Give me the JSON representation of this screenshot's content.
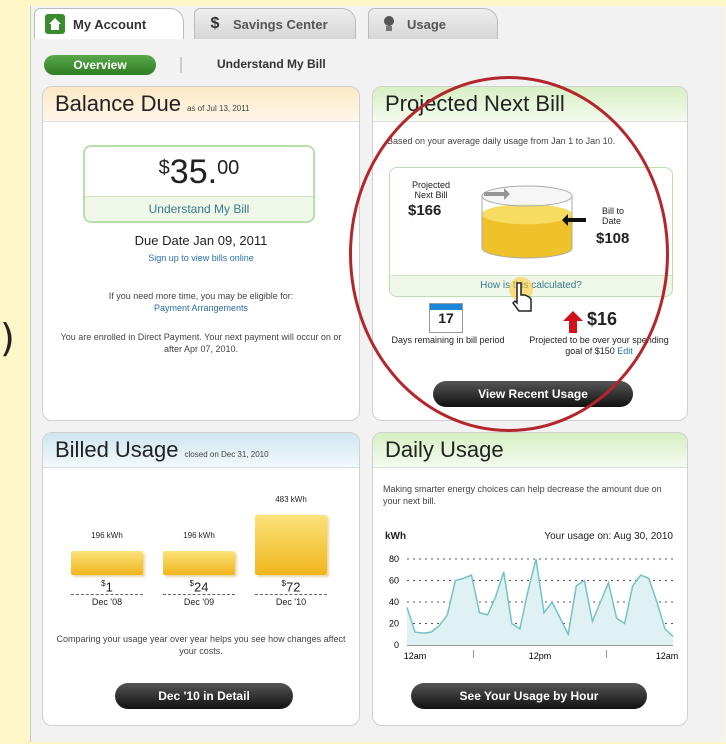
{
  "tabs": [
    {
      "label": "My Account",
      "icon": "home-icon"
    },
    {
      "label": "Savings Center",
      "icon": "dollar-icon"
    },
    {
      "label": "Usage",
      "icon": "bulb-icon"
    }
  ],
  "subnav": {
    "overview": "Overview",
    "understand": "Understand My Bill"
  },
  "left_edge": ")",
  "balance": {
    "title": "Balance Due",
    "as_of": "as of Jul 13, 2011",
    "currency": "$",
    "amount_main": "35.",
    "amount_cents": "00",
    "understand_link": "Understand My Bill",
    "due_label": "Due Date Jan 09, 2011",
    "signup": "Sign up to view bills online",
    "more_time": "If you need more time, you may be eligible for:",
    "arrangements": "Payment Arrangements",
    "direct_payment": "You are enrolled in Direct Payment. Your next payment will occur on or after Apr 07, 2010."
  },
  "projected": {
    "title": "Projected Next Bill",
    "desc": "Based on your average daily usage from Jan 1 to Jan 10.",
    "projected_label": "Projected Next Bill",
    "projected_amount": "$166",
    "todate_label": "Bill to Date",
    "todate_amount": "$108",
    "how_link": "How is this calculated?",
    "days": "17",
    "days_label": "Days remaining in bill period",
    "over_amount": "$16",
    "over_text": "Projected to be over your spending goal of $150",
    "edit": "Edit",
    "button": "View Recent Usage",
    "fill_fraction": 0.65
  },
  "billed": {
    "title": "Billed Usage",
    "closed": "closed on Dec 31, 2010",
    "bars": [
      {
        "kwh": "196 kWh",
        "cost": "1",
        "period": "Dec '08"
      },
      {
        "kwh": "196 kWh",
        "cost": "24",
        "period": "Dec '09"
      },
      {
        "kwh": "483 kWh",
        "cost": "72",
        "period": "Dec '10"
      }
    ],
    "note": "Comparing your usage year over year helps you see how changes affect your costs.",
    "button": "Dec '10 in Detail"
  },
  "daily": {
    "title": "Daily Usage",
    "desc": "Making smarter energy choices can help decrease the amount due on your next bill.",
    "button": "See Your Usage by Hour"
  },
  "chart_data": {
    "type": "area",
    "title": "Your usage on: Aug 30, 2010",
    "ylabel": "kWh",
    "yticks": [
      "80",
      "60",
      "40",
      "20",
      "0"
    ],
    "xticks": [
      "12am",
      "12pm",
      "12am"
    ],
    "ylim": [
      0,
      80
    ],
    "values": [
      35,
      12,
      11,
      12,
      18,
      28,
      60,
      62,
      65,
      30,
      28,
      45,
      68,
      20,
      15,
      50,
      80,
      30,
      40,
      25,
      10,
      55,
      60,
      22,
      40,
      58,
      25,
      20,
      55,
      65,
      62,
      40,
      15,
      8
    ]
  },
  "colors": {
    "green": "#3a8a2e",
    "accent_red": "#b3262b",
    "bar_gold": "#f2c52b",
    "line": "#74c2c9"
  }
}
